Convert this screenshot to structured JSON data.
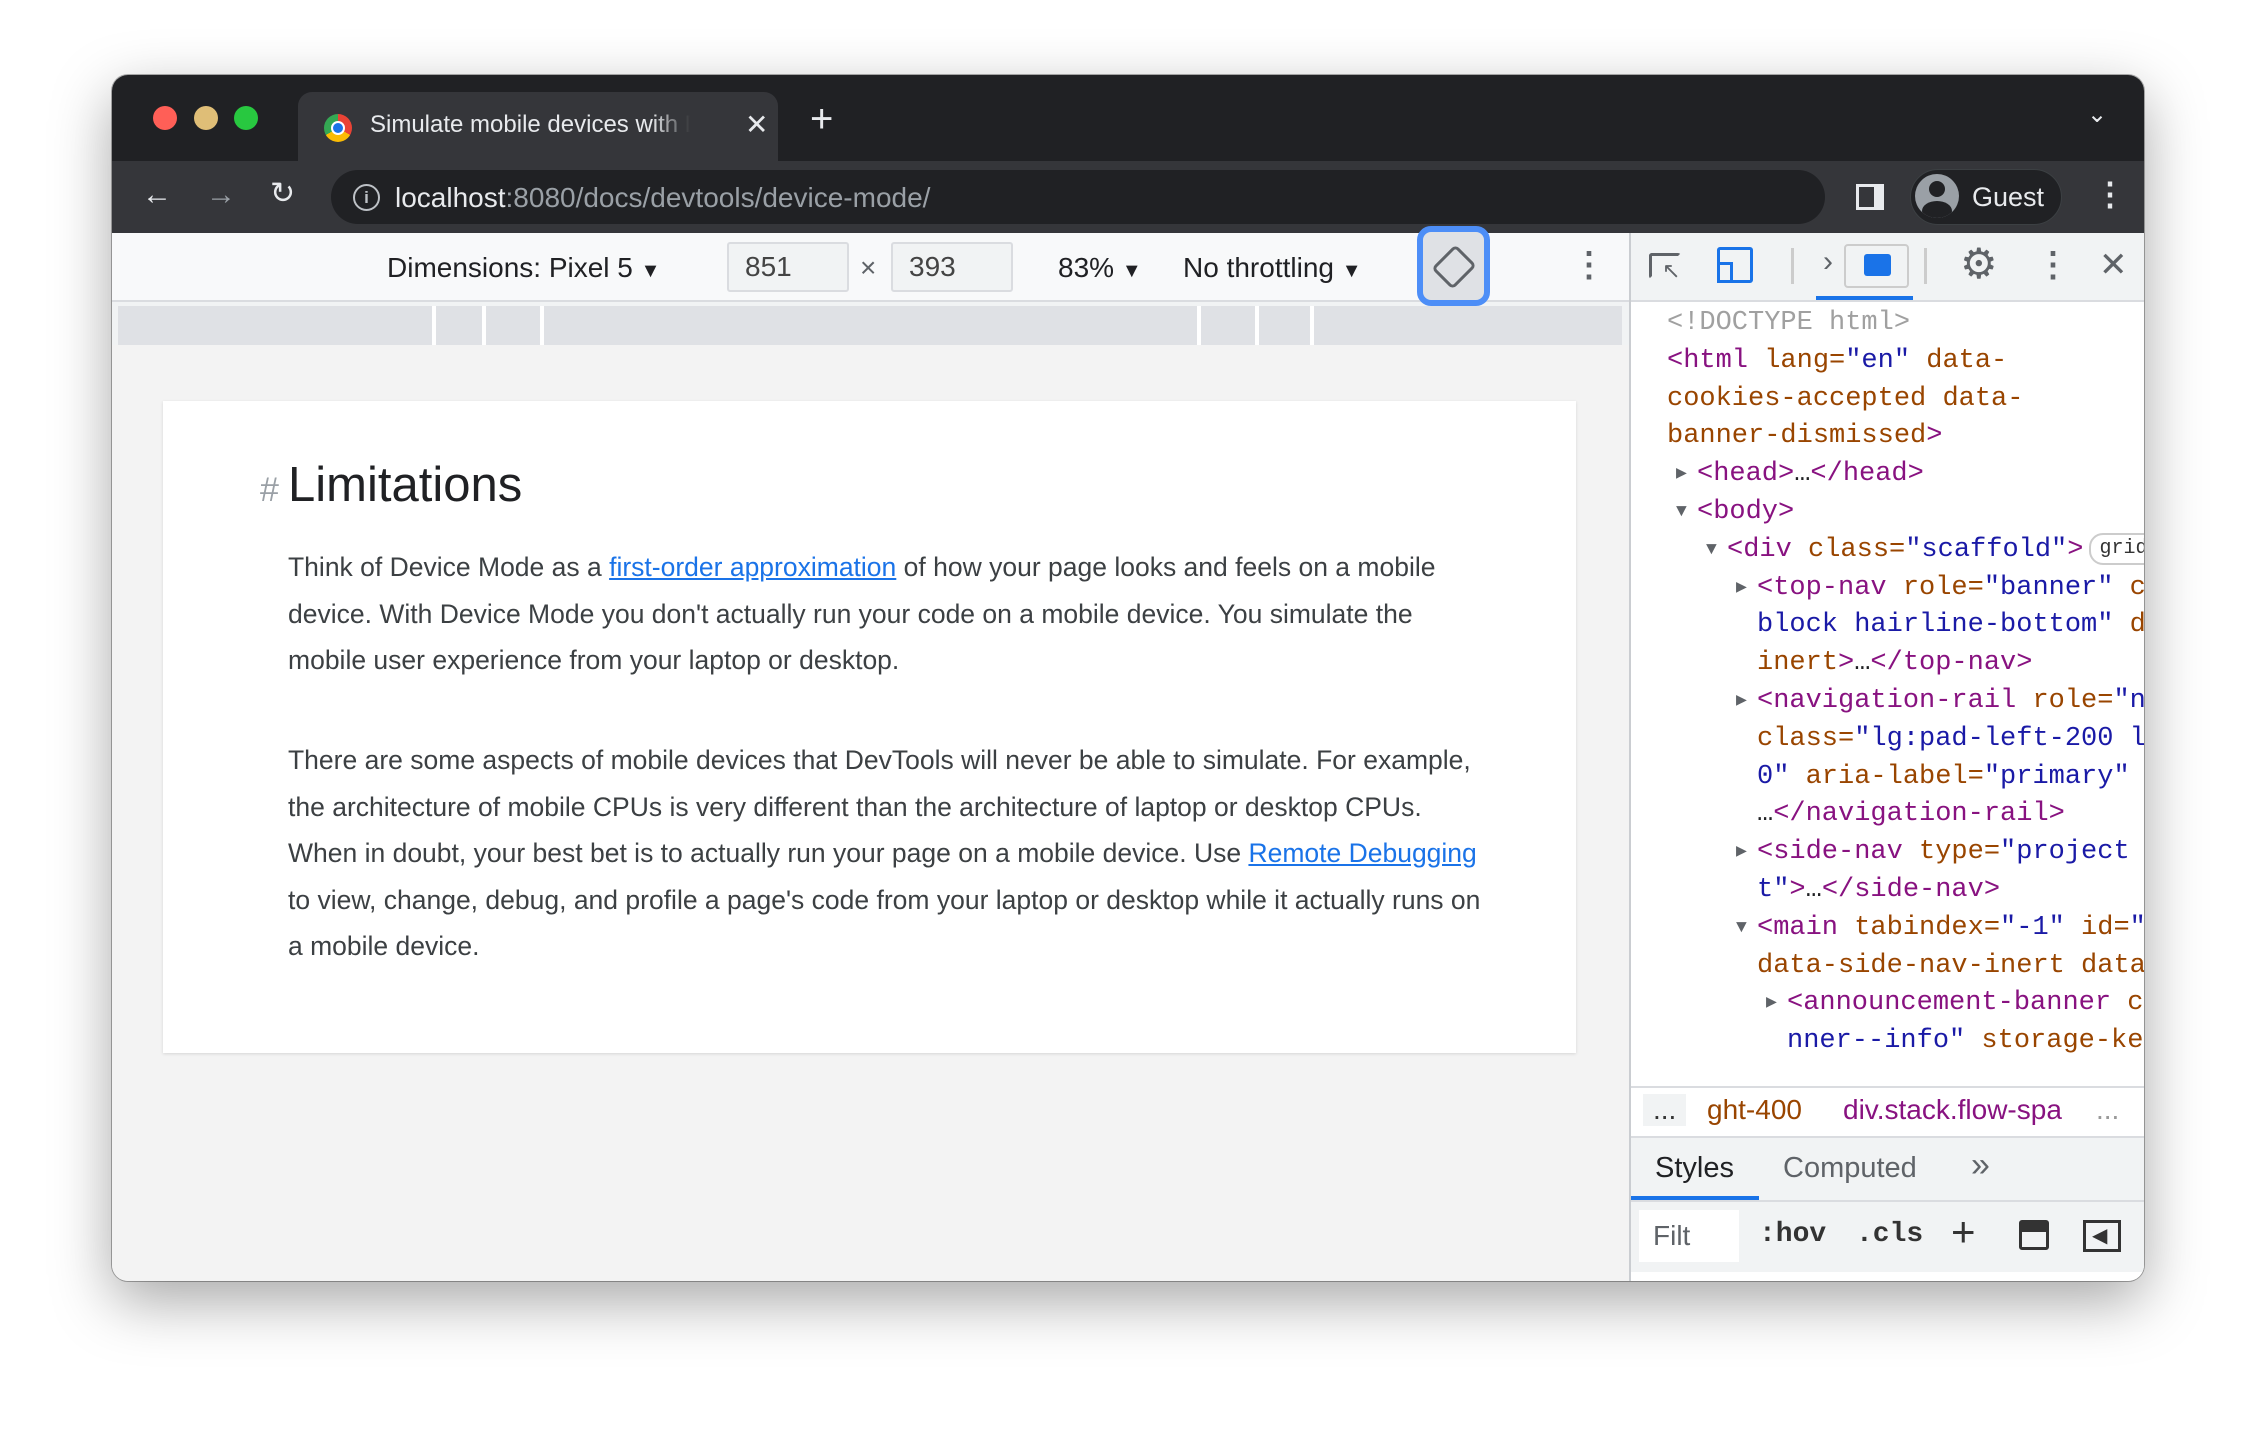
{
  "browser": {
    "tab_title": "Simulate mobile devices with DevTools",
    "url_host": "localhost",
    "url_rest": ":8080/docs/devtools/device-mode/",
    "profile_label": "Guest"
  },
  "device_toolbar": {
    "dimensions_label": "Dimensions: Pixel 5",
    "width": "851",
    "times": "×",
    "height": "393",
    "zoom": "83%",
    "throttling": "No throttling"
  },
  "page": {
    "heading_anchor": "#",
    "heading": "Limitations",
    "p1_a": "Think of Device Mode as a ",
    "p1_link": "first-order approximation",
    "p1_b": " of how your page looks and feels on a mobile device. With Device Mode you don't actually run your code on a mobile device. You simulate the mobile user experience from your laptop or desktop.",
    "p2_a": "There are some aspects of mobile devices that DevTools will never be able to simulate. For example, the architecture of mobile CPUs is very different than the architecture of laptop or desktop CPUs. When in doubt, your best bet is to actually run your page on a mobile device. Use ",
    "p2_link": "Remote Debugging",
    "p2_b": " to view, change, debug, and profile a page's code from your laptop or desktop while it actually runs on a mobile device."
  },
  "devtools": {
    "elements": [
      {
        "level": 0,
        "arrow": "",
        "tokens": [
          [
            "doc",
            "<!DOCTYPE html>"
          ]
        ]
      },
      {
        "level": 0,
        "arrow": "",
        "tokens": [
          [
            "tag",
            "<html"
          ],
          [
            "an",
            " lang="
          ],
          [
            "av",
            "\"en\""
          ],
          [
            "an",
            " data-"
          ]
        ]
      },
      {
        "level": 0,
        "arrow": "",
        "tokens": [
          [
            "an",
            "cookies-accepted data-"
          ]
        ]
      },
      {
        "level": 0,
        "arrow": "",
        "tokens": [
          [
            "an",
            "banner-dismissed"
          ],
          [
            "tag",
            ">"
          ]
        ]
      },
      {
        "level": 1,
        "arrow": "right",
        "tokens": [
          [
            "tag",
            "<head>"
          ],
          [
            "txt",
            "…"
          ],
          [
            "tag",
            "</head>"
          ]
        ]
      },
      {
        "level": 1,
        "arrow": "down",
        "tokens": [
          [
            "tag",
            "<body>"
          ]
        ]
      },
      {
        "level": 2,
        "arrow": "down",
        "tokens": [
          [
            "tag",
            "<div"
          ],
          [
            "an",
            " class="
          ],
          [
            "av",
            "\"scaffold\""
          ],
          [
            "tag",
            ">"
          ],
          [
            "badge",
            "grid"
          ]
        ]
      },
      {
        "level": 3,
        "arrow": "right",
        "tokens": [
          [
            "tag",
            "<top-nav"
          ],
          [
            "an",
            " role="
          ],
          [
            "av",
            "\"banner\""
          ],
          [
            "an",
            " c"
          ]
        ]
      },
      {
        "level": 3,
        "arrow": "",
        "tokens": [
          [
            "av",
            "block hairline-bottom\""
          ],
          [
            "an",
            " d"
          ]
        ]
      },
      {
        "level": 3,
        "arrow": "",
        "tokens": [
          [
            "an",
            "inert"
          ],
          [
            "tag",
            ">"
          ],
          [
            "txt",
            "…"
          ],
          [
            "tag",
            "</top-nav>"
          ]
        ]
      },
      {
        "level": 3,
        "arrow": "right",
        "tokens": [
          [
            "tag",
            "<navigation-rail"
          ],
          [
            "an",
            " role="
          ],
          [
            "av",
            "\"n"
          ]
        ]
      },
      {
        "level": 3,
        "arrow": "",
        "tokens": [
          [
            "an",
            "class="
          ],
          [
            "av",
            "\"lg:pad-left-200 l"
          ]
        ]
      },
      {
        "level": 3,
        "arrow": "",
        "tokens": [
          [
            "av",
            "0\""
          ],
          [
            "an",
            " aria-label="
          ],
          [
            "av",
            "\"primary\""
          ]
        ]
      },
      {
        "level": 3,
        "arrow": "",
        "tokens": [
          [
            "txt",
            "…"
          ],
          [
            "tag",
            "</navigation-rail>"
          ]
        ]
      },
      {
        "level": 3,
        "arrow": "right",
        "tokens": [
          [
            "tag",
            "<side-nav"
          ],
          [
            "an",
            " type="
          ],
          [
            "av",
            "\"project"
          ]
        ]
      },
      {
        "level": 3,
        "arrow": "",
        "tokens": [
          [
            "av",
            "t\""
          ],
          [
            "tag",
            ">"
          ],
          [
            "txt",
            "…"
          ],
          [
            "tag",
            "</side-nav>"
          ]
        ]
      },
      {
        "level": 3,
        "arrow": "down",
        "tokens": [
          [
            "tag",
            "<main"
          ],
          [
            "an",
            " tabindex="
          ],
          [
            "av",
            "\"-1\""
          ],
          [
            "an",
            " id="
          ],
          [
            "av",
            "\""
          ]
        ]
      },
      {
        "level": 3,
        "arrow": "",
        "tokens": [
          [
            "an",
            "data-side-nav-inert data"
          ]
        ]
      },
      {
        "level": 4,
        "arrow": "right",
        "tokens": [
          [
            "tag",
            "<announcement-banner"
          ],
          [
            "an",
            " c"
          ]
        ]
      },
      {
        "level": 4,
        "arrow": "",
        "tokens": [
          [
            "av",
            "nner--info\""
          ],
          [
            "an",
            " storage-ke"
          ]
        ]
      }
    ],
    "breadcrumb_more": "...",
    "breadcrumb_1": "ght-400",
    "breadcrumb_2": "div.stack.flow-spa",
    "breadcrumb_more_right": "...",
    "tabs": {
      "styles": "Styles",
      "computed": "Computed",
      "more": "»"
    },
    "filter_placeholder": "Filt",
    "hov": ":hov",
    "cls": ".cls",
    "plus": "+"
  },
  "colors": {
    "accent": "#1a73e8",
    "focus_ring": "#4d8ef7",
    "tag": "#881280",
    "attr_name": "#994500",
    "attr_value": "#1a1aa6"
  }
}
